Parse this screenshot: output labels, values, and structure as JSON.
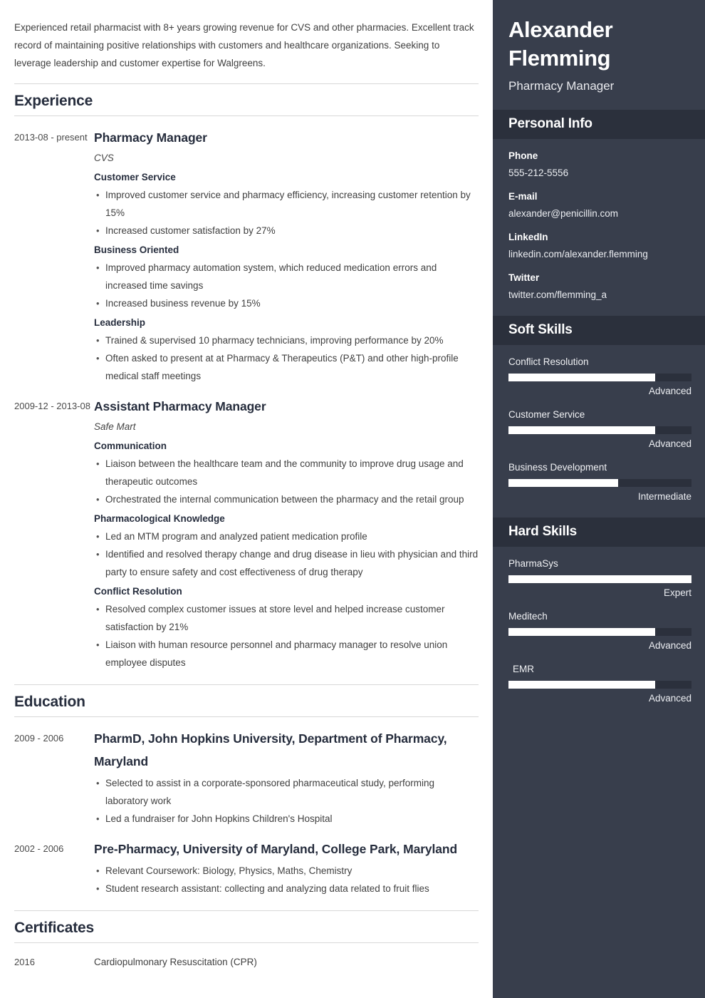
{
  "summary": "Experienced retail pharmacist with 8+ years growing revenue for CVS and other pharmacies. Excellent track record of maintaining positive relationships with customers and healthcare organizations. Seeking to leverage leadership and customer expertise for Walgreens.",
  "sections": {
    "experience_title": "Experience",
    "education_title": "Education",
    "certificates_title": "Certificates"
  },
  "experience": [
    {
      "date": "2013-08 - present",
      "title": "Pharmacy Manager",
      "company": "CVS",
      "groups": [
        {
          "heading": "Customer Service",
          "bullets": [
            "Improved customer service and pharmacy efficiency, increasing customer retention by 15%",
            "Increased customer satisfaction by 27%"
          ]
        },
        {
          "heading": "Business Oriented",
          "bullets": [
            "Improved pharmacy automation system, which reduced medication errors and increased time savings",
            "Increased business revenue by 15%"
          ]
        },
        {
          "heading": "Leadership",
          "bullets": [
            "Trained & supervised 10 pharmacy technicians, improving performance by 20%",
            "Often asked to present at at Pharmacy & Therapeutics (P&T) and other high-profile medical staff meetings"
          ]
        }
      ]
    },
    {
      "date": "2009-12 - 2013-08",
      "title": "Assistant Pharmacy Manager",
      "company": "Safe Mart",
      "groups": [
        {
          "heading": "Communication",
          "bullets": [
            "Liaison between the healthcare team and the community to improve drug usage and therapeutic outcomes",
            "Orchestrated the internal communication between the pharmacy and the retail group"
          ]
        },
        {
          "heading": "Pharmacological Knowledge",
          "bullets": [
            "Led an MTM program and analyzed patient medication profile",
            "Identified and resolved therapy change and drug disease in lieu with physician and third party to ensure safety and cost effectiveness of drug therapy"
          ]
        },
        {
          "heading": "Conflict Resolution",
          "bullets": [
            "Resolved complex customer issues at store level and helped increase customer satisfaction by 21%",
            "Liaison with human resource personnel and pharmacy manager to resolve union employee disputes"
          ]
        }
      ]
    }
  ],
  "education": [
    {
      "date": "2009 - 2006",
      "title": "PharmD, John Hopkins University, Department of Pharmacy, Maryland",
      "bullets": [
        "Selected to assist in a corporate-sponsored pharmaceutical study, performing laboratory work",
        "Led a fundraiser for John Hopkins Children's Hospital"
      ]
    },
    {
      "date": "2002 - 2006",
      "title": "Pre-Pharmacy, University of Maryland, College Park, Maryland",
      "bullets": [
        "Relevant Coursework: Biology, Physics, Maths, Chemistry",
        "Student research assistant: collecting and analyzing data related to fruit flies"
      ]
    }
  ],
  "certificates": [
    {
      "date": "2016",
      "name": "Cardiopulmonary Resuscitation (CPR)"
    }
  ],
  "sidebar": {
    "name": "Alexander Flemming",
    "role": "Pharmacy Manager",
    "personal_info_title": "Personal Info",
    "personal_info": [
      {
        "label": "Phone",
        "value": "555-212-5556"
      },
      {
        "label": "E-mail",
        "value": "alexander@penicillin.com"
      },
      {
        "label": "LinkedIn",
        "value": "linkedin.com/alexander.flemming"
      },
      {
        "label": "Twitter",
        "value": "twitter.com/flemming_a"
      }
    ],
    "soft_skills_title": "Soft Skills",
    "soft_skills": [
      {
        "name": "Conflict Resolution",
        "level": "Advanced",
        "percent": 80
      },
      {
        "name": "Customer Service",
        "level": "Advanced",
        "percent": 80
      },
      {
        "name": "Business Development",
        "level": "Intermediate",
        "percent": 60
      }
    ],
    "hard_skills_title": "Hard Skills",
    "hard_skills": [
      {
        "name": "PharmaSys",
        "level": "Expert",
        "percent": 100
      },
      {
        "name": "Meditech",
        "level": "Advanced",
        "percent": 80
      },
      {
        "name": "EMR",
        "level": "Advanced",
        "percent": 80,
        "indent": true
      }
    ]
  },
  "colors": {
    "sidebar_bg": "#383e4c",
    "sidebar_band_bg": "#2b303c",
    "heading": "#262d3d",
    "body_text": "#3f3f3f",
    "bar_fill": "#ffffff"
  }
}
